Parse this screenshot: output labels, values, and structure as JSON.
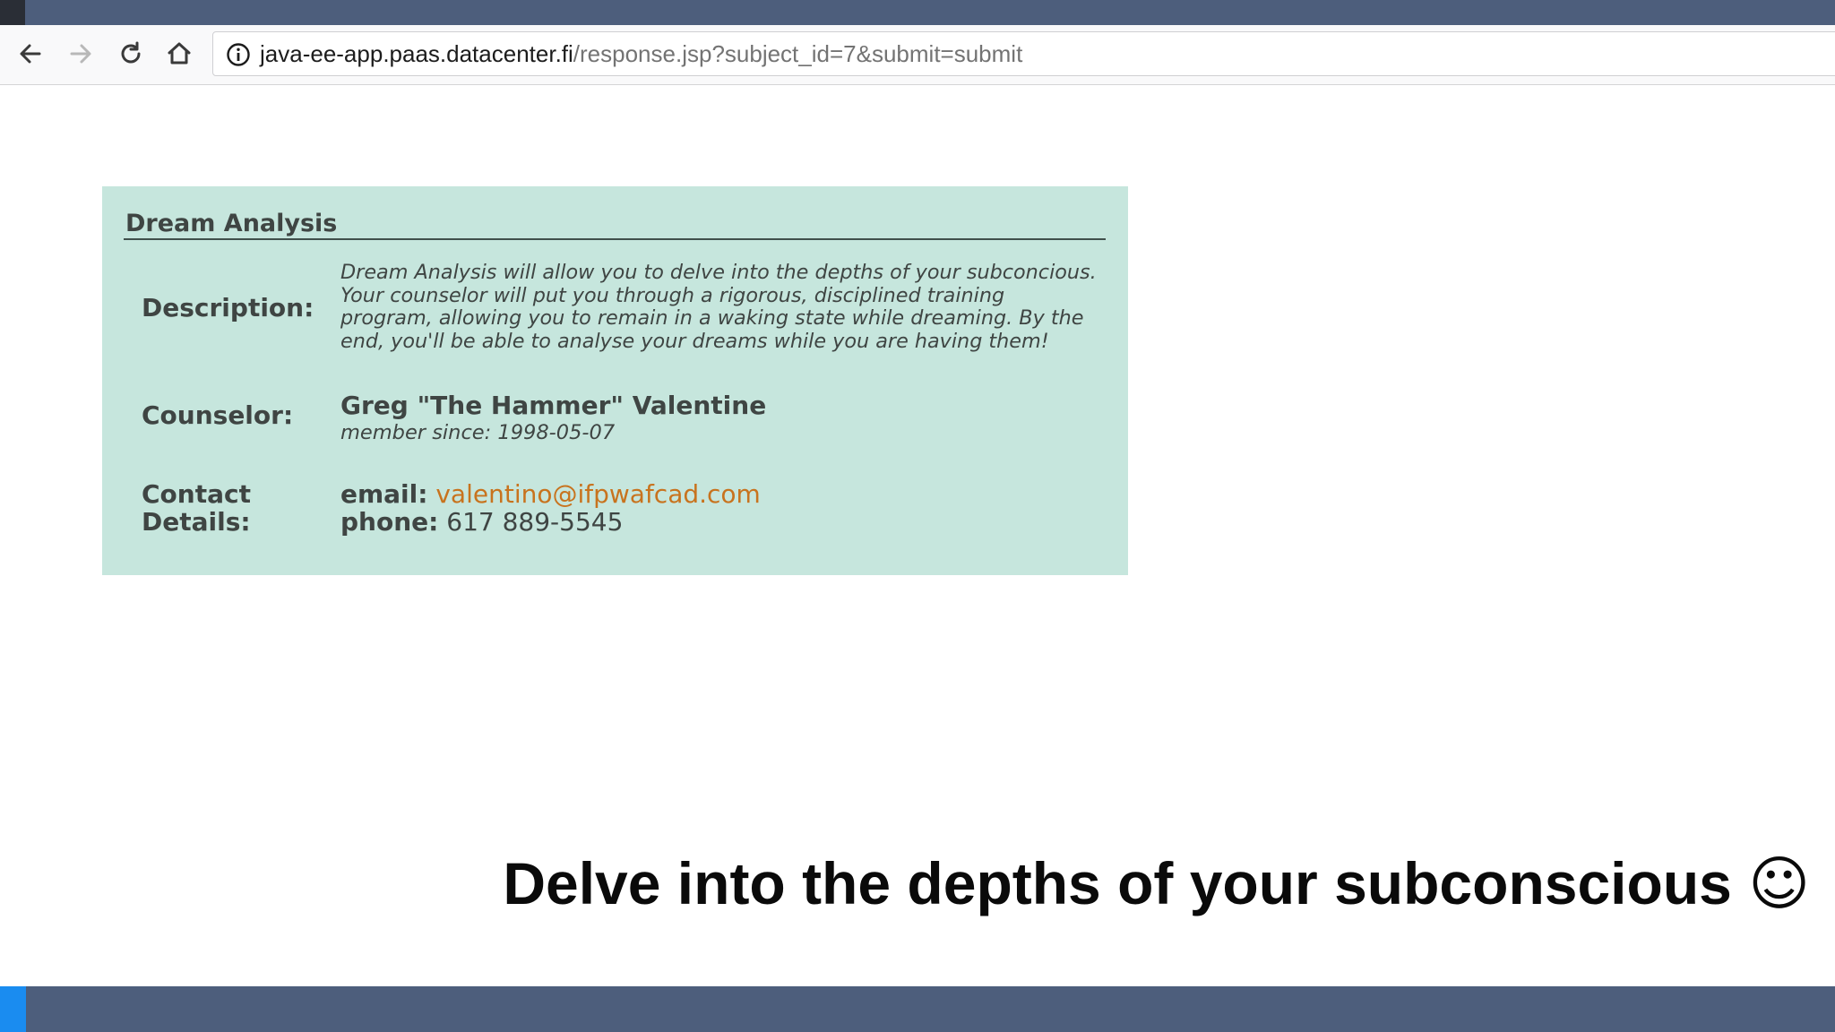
{
  "browser": {
    "url_host": "java-ee-app.paas.datacenter.fi",
    "url_path": "/response.jsp?subject_id=7&submit=submit",
    "icons": {
      "back": "arrow-left-icon",
      "forward": "arrow-right-icon",
      "reload": "reload-icon",
      "home": "home-icon",
      "info": "info-icon"
    }
  },
  "card": {
    "title": "Dream Analysis",
    "description_label": "Description:",
    "description_lines": [
      "Dream Analysis will allow you to delve into the depths of your subconcious.",
      "Your counselor will put you through a rigorous, disciplined training",
      "program, allowing you to remain in a waking state while dreaming. By the",
      "end, you'll be able to analyse your dreams while you are having them!"
    ],
    "counselor_label": "Counselor:",
    "counselor_name": "Greg \"The Hammer\" Valentine",
    "member_since": "member since: 1998-05-07",
    "contact_label_1": "Contact",
    "contact_label_2": "Details:",
    "email_key": "email:",
    "email_value": "valentino@ifpwafcad.com",
    "phone_key": "phone:",
    "phone_value": "617 889-5545"
  },
  "caption": {
    "text": "Delve into the depths of your subconscious",
    "emoji": "☺"
  },
  "colors": {
    "top_bar": "#4d5e7c",
    "card_bg": "#c6e6dd",
    "link": "#c8731e",
    "bottom_accent": "#1a8cf0"
  }
}
